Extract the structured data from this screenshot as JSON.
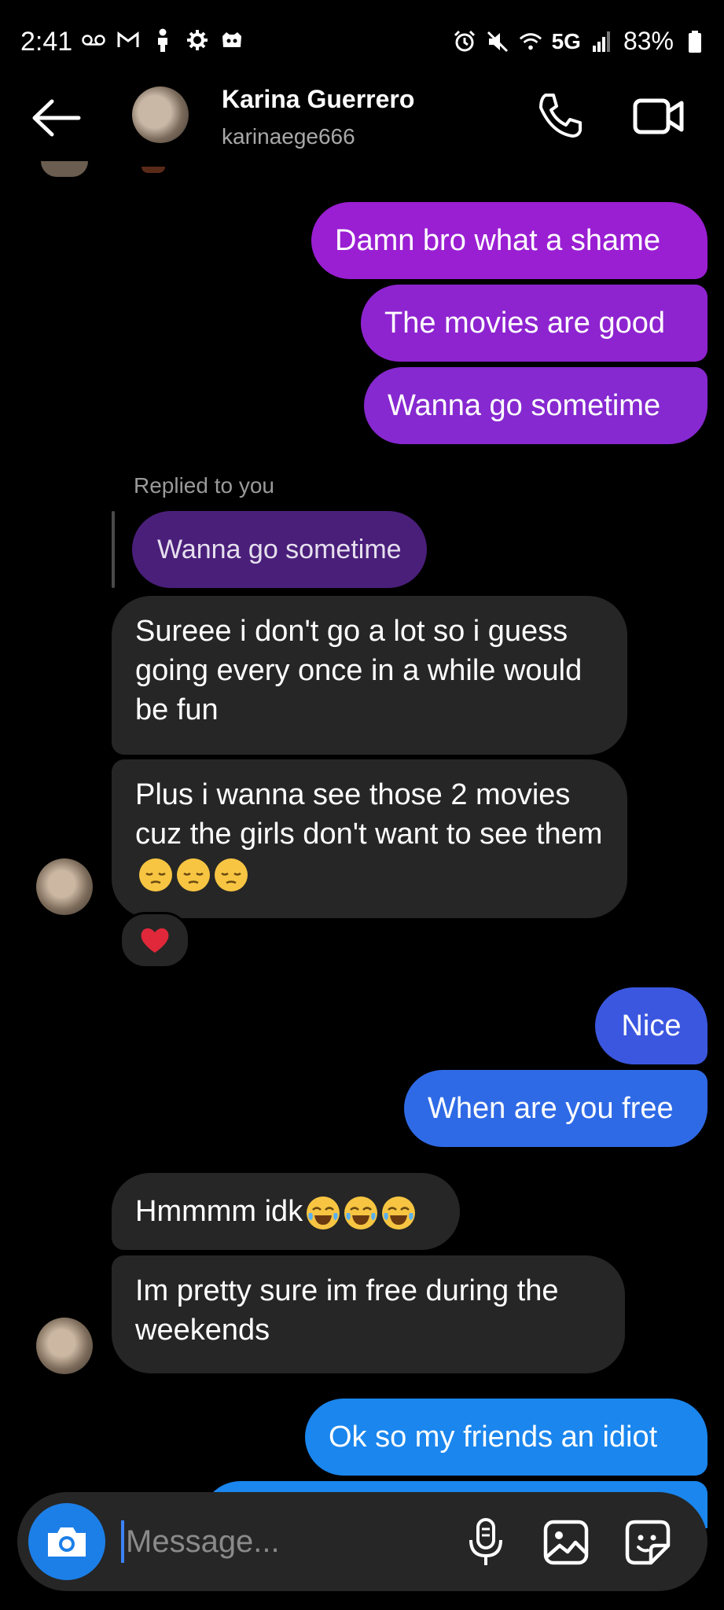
{
  "status": {
    "time": "2:41",
    "battery": "83%",
    "network": "5G"
  },
  "header": {
    "name": "Karina Guerrero",
    "handle": "karinaege666"
  },
  "messages": {
    "sent1": "Damn bro what a shame",
    "sent2": "The movies are good",
    "sent3": "Wanna go sometime",
    "reply_label": "Replied to you",
    "reply_quote": "Wanna go sometime",
    "recv1": "Sureee i don't go a lot so i guess going every once in a while would be fun",
    "recv2": "Plus i wanna see those 2 movies cuz the girls don't want to see them",
    "sent4": "Nice",
    "sent5": "When are you free",
    "recv3": "Hmmmm idk",
    "recv4": "Im pretty sure im free during the weekends",
    "sent6": "Ok so my friends an idiot"
  },
  "composer": {
    "placeholder": "Message..."
  },
  "colors": {
    "sent_purple": "#9a1fd3",
    "sent_blue": "#3b57e0",
    "sent_cyan": "#1a86ee",
    "received": "#262626",
    "reaction_heart": "#e0283a"
  },
  "icons": {
    "reaction": "heart-icon",
    "emoji_recv2": "pensive-face-icon",
    "emoji_recv3": "tears-of-joy-icon"
  }
}
